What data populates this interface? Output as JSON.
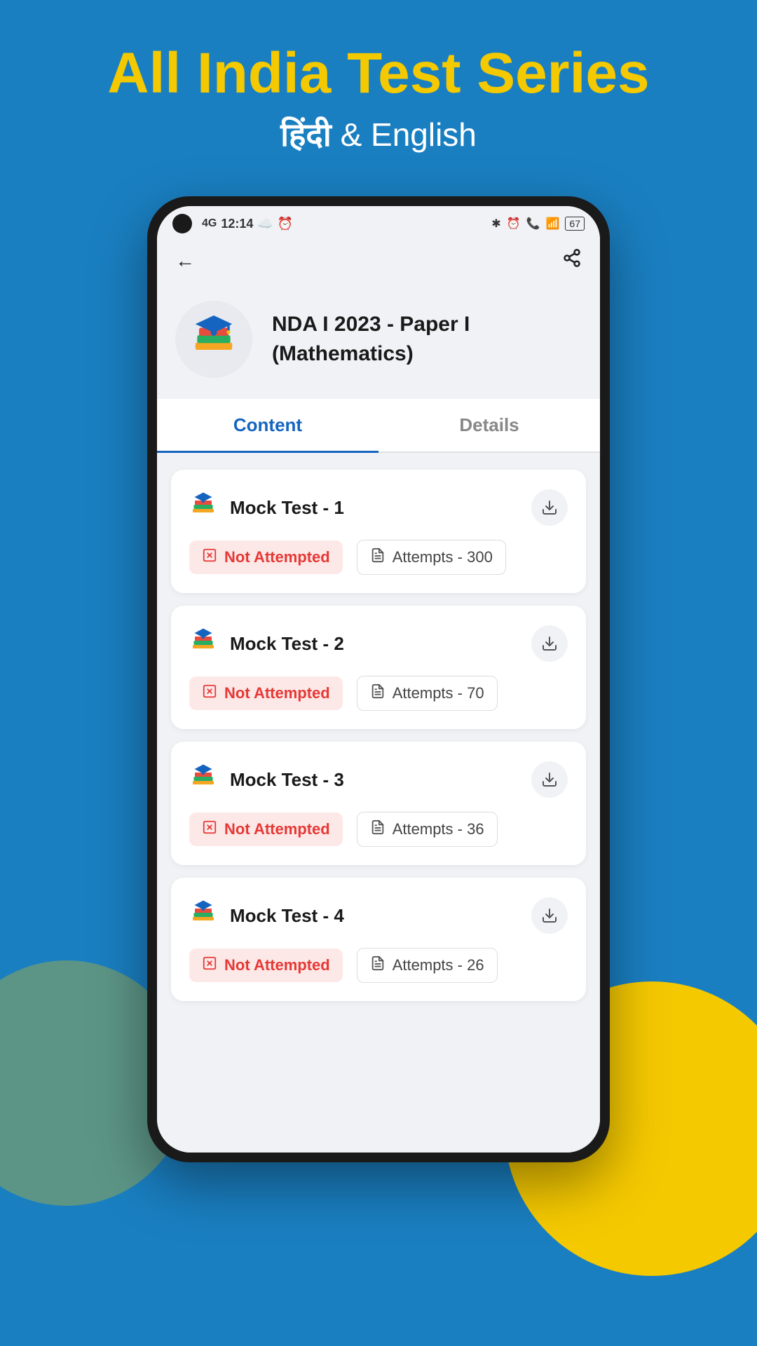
{
  "app": {
    "title": "All India Test Series",
    "subtitle_hindi": "हिंदी",
    "subtitle_eng": "& English"
  },
  "status_bar": {
    "signal": "4G",
    "time": "12:14",
    "battery": "67"
  },
  "nav": {
    "back_label": "←",
    "share_label": "⋮"
  },
  "course": {
    "title": "NDA I 2023 - Paper I (Mathematics)",
    "icon": "🎓"
  },
  "tabs": [
    {
      "id": "content",
      "label": "Content",
      "active": true
    },
    {
      "id": "details",
      "label": "Details",
      "active": false
    }
  ],
  "tests": [
    {
      "id": 1,
      "name": "Mock Test - 1",
      "status": "Not Attempted",
      "attempts_label": "Attempts - 300"
    },
    {
      "id": 2,
      "name": "Mock Test - 2",
      "status": "Not Attempted",
      "attempts_label": "Attempts - 70"
    },
    {
      "id": 3,
      "name": "Mock Test - 3",
      "status": "Not Attempted",
      "attempts_label": "Attempts - 36"
    },
    {
      "id": 4,
      "name": "Mock Test - 4",
      "status": "Not Attempted",
      "attempts_label": "Attempts - 26"
    }
  ],
  "colors": {
    "accent_blue": "#1565c0",
    "accent_yellow": "#f5c900",
    "background_blue": "#1a7fc1",
    "not_attempted_bg": "#fde8e8",
    "not_attempted_text": "#e53935"
  }
}
